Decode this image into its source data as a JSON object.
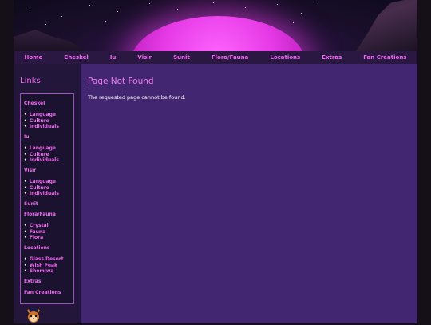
{
  "nav": [
    "Home",
    "Cheskel",
    "Iu",
    "Visir",
    "Sunit",
    "Flora/Fauna",
    "Locations",
    "Extras",
    "Fan Creations"
  ],
  "sidebar": {
    "title": "Links",
    "sections": [
      {
        "label": "Cheskel",
        "items": [
          "Language",
          "Culture",
          "Individuals"
        ]
      },
      {
        "label": "Iu",
        "items": [
          "Language",
          "Culture",
          "Individuals"
        ]
      },
      {
        "label": "Visir",
        "items": [
          "Language",
          "Culture",
          "Individuals"
        ]
      },
      {
        "label": "Sunit",
        "items": []
      },
      {
        "label": "Flora/Fauna",
        "items": [
          "Crystal",
          "Fauna",
          "Flora"
        ]
      },
      {
        "label": "Locations",
        "items": [
          "Glass Desert",
          "Wish Peak",
          "Shomiwa"
        ]
      },
      {
        "label": "Extras",
        "items": []
      },
      {
        "label": "Fan Creations",
        "items": []
      }
    ]
  },
  "main": {
    "title": "Page Not Found",
    "message": "The requested page cannot be found."
  },
  "colors": {
    "accent": "#f06af0",
    "content_bg": "#432672",
    "sidebar_bg": "#22163a",
    "nav_bg": "#2a1843"
  }
}
